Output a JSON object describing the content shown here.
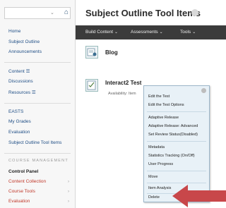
{
  "sidebar": {
    "top_chevron": "⌄",
    "top_home_icon": "home-icon",
    "items": [
      {
        "label": "Home"
      },
      {
        "label": "Subject Outline"
      },
      {
        "label": "Announcements"
      },
      {
        "label": "Content ☰"
      },
      {
        "label": "Discussions"
      },
      {
        "label": "Resources ☰"
      },
      {
        "label": "EASTS"
      },
      {
        "label": "My Grades"
      },
      {
        "label": "Evaluation"
      },
      {
        "label": "Subject Outline Tool Items"
      }
    ],
    "course_management": {
      "heading": "COURSE MANAGEMENT",
      "items": [
        {
          "label": "Control Panel"
        },
        {
          "label": "Content Collection",
          "arrow": "›"
        },
        {
          "label": "Course Tools",
          "arrow": "›"
        },
        {
          "label": "Evaluation",
          "arrow": "›"
        }
      ]
    }
  },
  "main": {
    "page_title": "Subject Outline Tool Items",
    "action_bar": [
      {
        "label": "Build Content",
        "caret": "⌄"
      },
      {
        "label": "Assessments",
        "caret": "⌄"
      },
      {
        "label": "Tools",
        "caret": "⌄"
      }
    ],
    "content_items": [
      {
        "title": "Blog"
      },
      {
        "title": "Interact2 Test",
        "availability": "Availability: Item"
      }
    ]
  },
  "context_menu": {
    "items": [
      "Edit the Test",
      "Edit the Test Options",
      "Adaptive Release",
      "Adaptive Release: Advanced",
      "Set Review Status(Disabled)",
      "Metadata",
      "Statistics Tracking (On/Off)",
      "User Progress",
      "Move",
      "Item Analysis",
      "Delete"
    ]
  },
  "colors": {
    "action_bar": "#3b3b3b",
    "menu_bg": "#e8f1f7",
    "link": "#1f4e85",
    "sidebar_red": "#c0392b",
    "annotation_arrow": "#c8474a"
  }
}
